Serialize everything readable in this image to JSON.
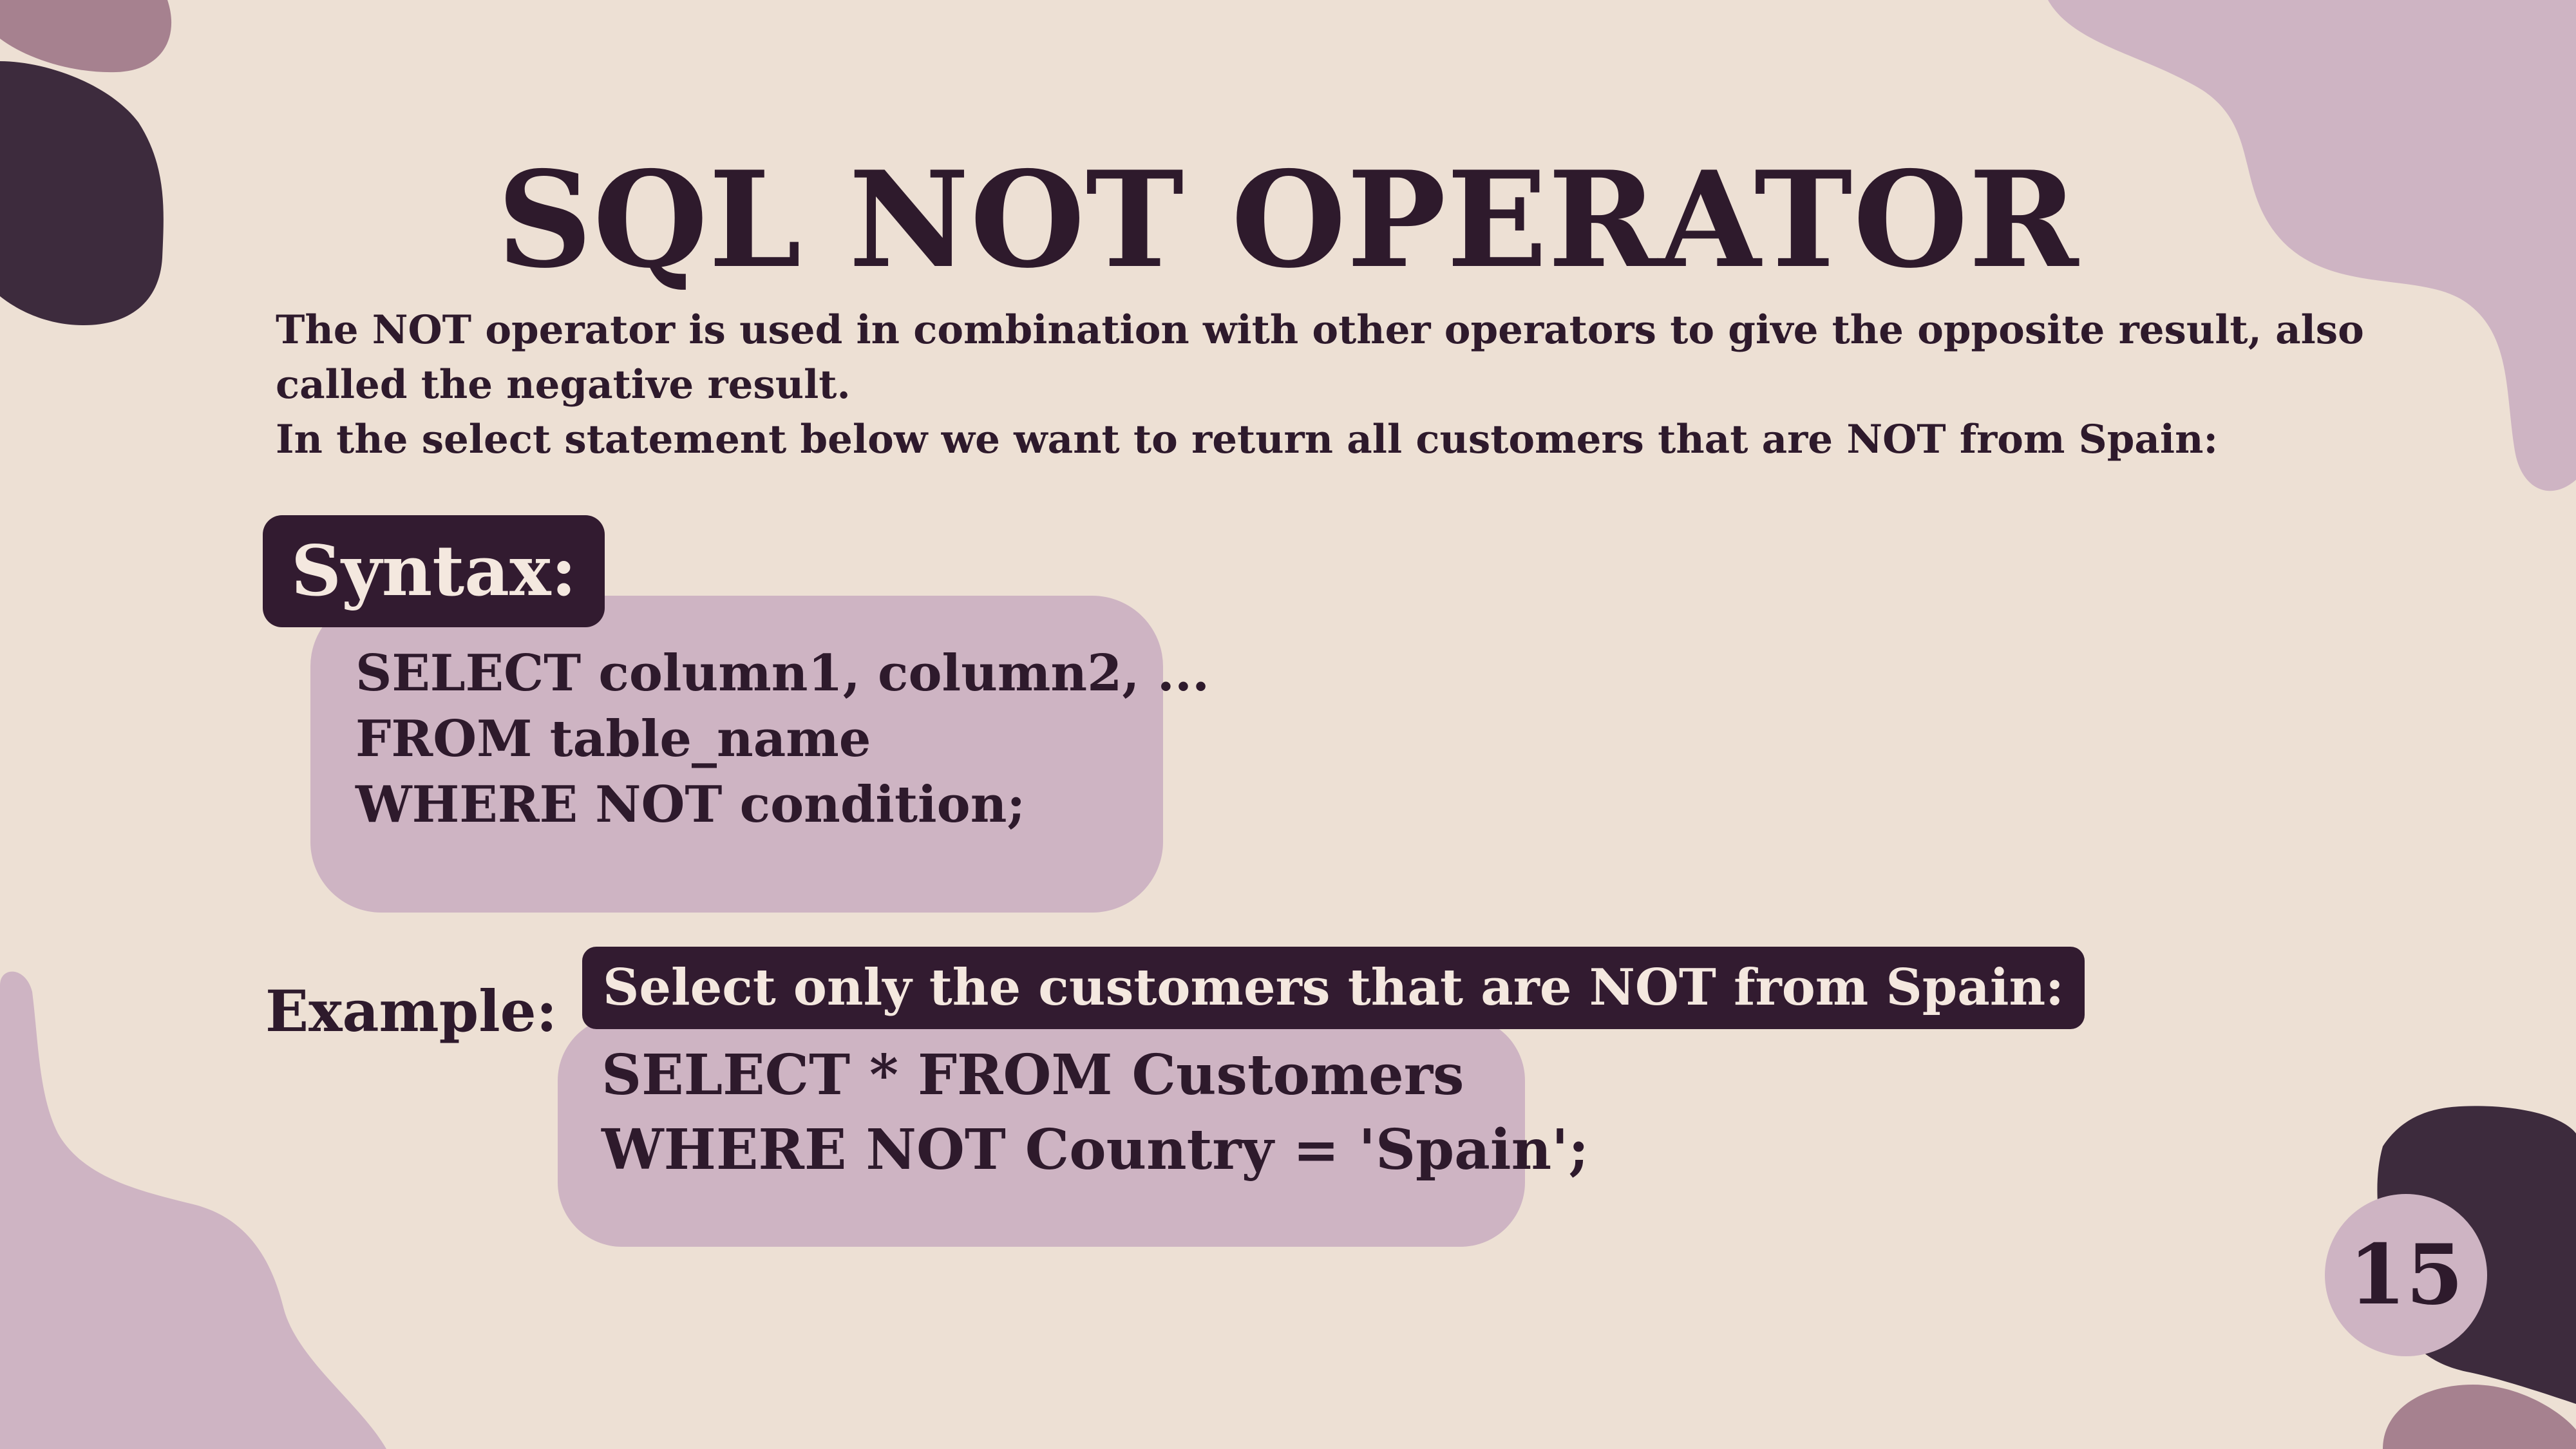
{
  "colors": {
    "background": "#ede0d4",
    "dark_plum": "#3d2b3d",
    "mauve": "#ceb4c3",
    "dusty_rose": "#a6818f",
    "text": "#2e1a2c",
    "label_text": "#f4e8df"
  },
  "slide": {
    "title": "SQL NOT OPERATOR",
    "intro_lines": [
      "The NOT operator is used in combination with other operators to give the opposite result, also called the negative result.",
      "In the select statement below we want to return all customers that are NOT from Spain:"
    ],
    "syntax": {
      "label": "Syntax:",
      "code_lines": [
        "SELECT column1, column2, ...",
        "FROM table_name",
        "WHERE NOT condition;"
      ]
    },
    "example": {
      "label": "Example:",
      "caption": "Select only the customers that are NOT from Spain:",
      "code_lines": [
        "SELECT * FROM Customers",
        "WHERE NOT Country = 'Spain';"
      ]
    },
    "page_number": "15"
  }
}
